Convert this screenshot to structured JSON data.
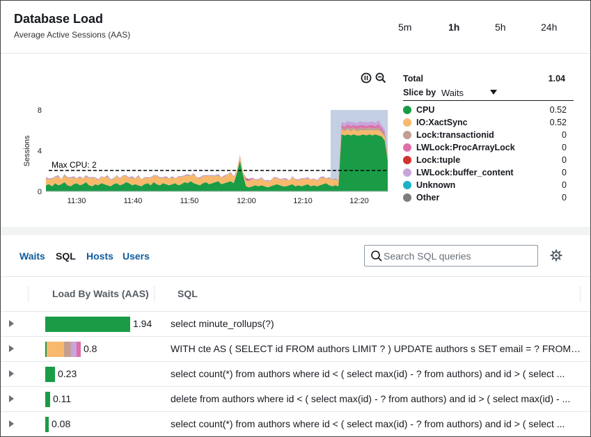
{
  "header": {
    "title": "Database Load",
    "subtitle": "Average Active Sessions (AAS)",
    "time_ranges": [
      "5m",
      "1h",
      "5h",
      "24h"
    ],
    "active_range": "1h"
  },
  "chart_data": {
    "type": "area",
    "ylabel": "Sessions",
    "yticks": [
      "0",
      "4",
      "8"
    ],
    "ylim": [
      0,
      9
    ],
    "xticks": [
      "11:30",
      "11:40",
      "11:50",
      "12:00",
      "12:10",
      "12:20"
    ],
    "threshold": {
      "label": "Max CPU: 2",
      "value": 2
    },
    "selection": {
      "from": "12:15",
      "to": "12:25"
    },
    "series": [
      {
        "name": "CPU",
        "color": "#1a9c46",
        "values": [
          0.6,
          0.7,
          0.5,
          0.8,
          0.6,
          0.7,
          0.9,
          0.6,
          0.5,
          0.7,
          0.8,
          0.6,
          0.7,
          0.9,
          0.6,
          0.5,
          0.7,
          0.6,
          0.8,
          0.7,
          0.6,
          0.5,
          0.7,
          0.8,
          0.6,
          0.7,
          0.9,
          0.8,
          0.6,
          0.7,
          0.6,
          0.5,
          0.7,
          0.8,
          0.6,
          0.9,
          0.7,
          0.6,
          0.8,
          0.7,
          0.6,
          0.7,
          0.8,
          0.6,
          0.7,
          0.9,
          0.8,
          1.0,
          0.8,
          0.7,
          0.6,
          0.8,
          0.9,
          0.7,
          0.8,
          0.9,
          1.0,
          0.7,
          0.8,
          0.9,
          1.0,
          0.8,
          1.8,
          3.0,
          1.6,
          0.5,
          0.4,
          0.5,
          0.6,
          0.5,
          0.6,
          0.5,
          0.4,
          0.5,
          0.6,
          0.7,
          0.6,
          0.5,
          0.5,
          0.6,
          0.7,
          0.5,
          0.6,
          0.5,
          0.6,
          0.7,
          0.5,
          0.6,
          0.5,
          0.6,
          0.7,
          0.8,
          0.6,
          0.5,
          0.6,
          0.5,
          5.6,
          5.5,
          5.6,
          5.5,
          5.6,
          5.5,
          5.5,
          5.6,
          5.5,
          5.6,
          5.5,
          5.6,
          5.5,
          5.4,
          5.0,
          3.0
        ]
      },
      {
        "name": "IO:XactSync",
        "color": "#f8b96d",
        "values": [
          0.6,
          0.5,
          0.7,
          0.6,
          0.8,
          0.5,
          0.6,
          0.7,
          0.8,
          0.6,
          0.5,
          0.7,
          0.6,
          0.5,
          0.7,
          0.8,
          0.6,
          0.5,
          0.6,
          0.7,
          0.8,
          0.6,
          0.5,
          0.7,
          0.6,
          0.8,
          0.6,
          0.5,
          0.7,
          0.6,
          0.8,
          0.7,
          0.6,
          0.5,
          0.7,
          0.6,
          0.8,
          0.7,
          0.5,
          0.6,
          0.7,
          0.6,
          0.5,
          0.8,
          0.7,
          0.6,
          0.7,
          0.6,
          0.8,
          0.7,
          0.6,
          0.7,
          0.6,
          0.8,
          0.7,
          0.6,
          0.5,
          0.7,
          0.6,
          0.8,
          0.7,
          0.6,
          0.3,
          0.4,
          0.3,
          0.5,
          0.6,
          0.7,
          0.5,
          0.6,
          0.7,
          0.5,
          0.6,
          0.5,
          0.7,
          0.6,
          0.5,
          0.7,
          0.6,
          0.5,
          0.7,
          0.6,
          0.5,
          0.7,
          0.6,
          0.5,
          0.7,
          0.6,
          0.5,
          0.7,
          0.6,
          0.5,
          0.6,
          0.7,
          0.5,
          0.6,
          0.5,
          0.4,
          0.5,
          0.4,
          0.5,
          0.4,
          0.5,
          0.4,
          0.5,
          0.4,
          0.5,
          0.4,
          0.5,
          0.4,
          0.4,
          0.3
        ]
      },
      {
        "name": "Lock:transactionid",
        "color": "#c39e91",
        "values": [
          0.1,
          0,
          0.1,
          0,
          0.1,
          0,
          0.1,
          0.1,
          0,
          0.1,
          0,
          0.1,
          0,
          0.1,
          0,
          0.1,
          0,
          0.1,
          0,
          0,
          0.1,
          0,
          0.1,
          0,
          0.1,
          0,
          0.1,
          0,
          0.1,
          0,
          0.1,
          0,
          0,
          0.1,
          0,
          0.1,
          0,
          0.1,
          0,
          0.1,
          0,
          0.1,
          0,
          0,
          0.1,
          0,
          0.1,
          0,
          0.1,
          0,
          0.1,
          0,
          0.1,
          0,
          0.1,
          0,
          0.1,
          0,
          0.1,
          0,
          0.1,
          0,
          0,
          0.1,
          0,
          0.1,
          0,
          0.1,
          0,
          0.1,
          0,
          0,
          0.1,
          0,
          0.1,
          0,
          0.1,
          0,
          0.1,
          0,
          0,
          0.1,
          0,
          0.1,
          0,
          0.1,
          0,
          0,
          0.1,
          0,
          0.1,
          0,
          0.1,
          0,
          0.1,
          0,
          0.2,
          0.2,
          0.2,
          0.3,
          0.2,
          0.2,
          0.3,
          0.2,
          0.2,
          0.3,
          0.2,
          0.2,
          0.3,
          0.2,
          0.2,
          0.1
        ]
      },
      {
        "name": "LWLock:ProcArrayLock",
        "color": "#de6fa9",
        "values": [
          0,
          0,
          0,
          0,
          0,
          0,
          0,
          0,
          0,
          0,
          0,
          0,
          0,
          0,
          0,
          0,
          0,
          0,
          0,
          0,
          0,
          0,
          0,
          0,
          0,
          0,
          0,
          0,
          0,
          0,
          0,
          0,
          0,
          0,
          0,
          0,
          0,
          0,
          0,
          0,
          0,
          0,
          0,
          0,
          0,
          0,
          0,
          0,
          0,
          0,
          0,
          0,
          0,
          0,
          0,
          0,
          0,
          0,
          0,
          0,
          0,
          0,
          0,
          0,
          0,
          0.05,
          0.1,
          0.05,
          0,
          0,
          0,
          0,
          0,
          0,
          0,
          0,
          0,
          0,
          0,
          0,
          0,
          0,
          0,
          0,
          0,
          0,
          0,
          0,
          0,
          0,
          0,
          0,
          0,
          0,
          0,
          0,
          0.2,
          0.2,
          0.3,
          0.2,
          0.2,
          0.3,
          0.2,
          0.3,
          0.2,
          0.2,
          0.3,
          0.2,
          0.3,
          0.2,
          0.2,
          0.1
        ]
      },
      {
        "name": "Lock:tuple",
        "color": "#d23232",
        "values": [
          0,
          0,
          0,
          0,
          0,
          0,
          0,
          0,
          0,
          0,
          0,
          0,
          0,
          0,
          0,
          0,
          0,
          0,
          0,
          0,
          0,
          0,
          0,
          0,
          0,
          0,
          0,
          0,
          0,
          0,
          0,
          0,
          0,
          0,
          0,
          0,
          0,
          0,
          0,
          0,
          0,
          0,
          0,
          0,
          0,
          0,
          0,
          0,
          0,
          0,
          0,
          0,
          0,
          0,
          0,
          0,
          0,
          0,
          0,
          0,
          0,
          0,
          0,
          0,
          0,
          0.1,
          0.05,
          0,
          0,
          0,
          0,
          0,
          0,
          0,
          0,
          0,
          0,
          0,
          0,
          0,
          0,
          0,
          0,
          0,
          0,
          0,
          0,
          0,
          0,
          0,
          0,
          0,
          0,
          0,
          0,
          0,
          0,
          0,
          0,
          0,
          0,
          0,
          0,
          0,
          0,
          0,
          0,
          0,
          0,
          0,
          0,
          0
        ]
      },
      {
        "name": "LWLock:buffer_content",
        "color": "#c8a4da",
        "values": [
          0.1,
          0.1,
          0,
          0.1,
          0.1,
          0,
          0.1,
          0,
          0.1,
          0.1,
          0,
          0.1,
          0,
          0.1,
          0.1,
          0,
          0.1,
          0,
          0.1,
          0,
          0.1,
          0.1,
          0,
          0.1,
          0,
          0.1,
          0,
          0.1,
          0.1,
          0,
          0.1,
          0,
          0.1,
          0,
          0.1,
          0,
          0.1,
          0,
          0.1,
          0.1,
          0,
          0.1,
          0,
          0.1,
          0,
          0.1,
          0.1,
          0,
          0.1,
          0,
          0.1,
          0.1,
          0,
          0.1,
          0,
          0.1,
          0.1,
          0,
          0.1,
          0,
          0.1,
          0.1,
          0,
          0.1,
          0,
          0.1,
          0.1,
          0,
          0.1,
          0,
          0.1,
          0.1,
          0,
          0.1,
          0,
          0.1,
          0,
          0.1,
          0.1,
          0,
          0.1,
          0,
          0.1,
          0,
          0.1,
          0.1,
          0,
          0.1,
          0,
          0.1,
          0.1,
          0,
          0.1,
          0,
          0.1,
          0,
          0.3,
          0.4,
          0.3,
          0.4,
          0.3,
          0.3,
          0.4,
          0.3,
          0.4,
          0.3,
          0.4,
          0.3,
          0.4,
          0.3,
          0.3,
          0.2
        ]
      }
    ]
  },
  "legend": {
    "total_label": "Total",
    "total_value": "1.04",
    "slice_label": "Slice by",
    "slice_value": "Waits",
    "items": [
      {
        "name": "CPU",
        "value": "0.52",
        "color": "#1a9c46"
      },
      {
        "name": "IO:XactSync",
        "value": "0.52",
        "color": "#f8b96d"
      },
      {
        "name": "Lock:transactionid",
        "value": "0",
        "color": "#c39e91"
      },
      {
        "name": "LWLock:ProcArrayLock",
        "value": "0",
        "color": "#de6fa9"
      },
      {
        "name": "Lock:tuple",
        "value": "0",
        "color": "#d23232"
      },
      {
        "name": "LWLock:buffer_content",
        "value": "0",
        "color": "#c8a4da"
      },
      {
        "name": "Unknown",
        "value": "0",
        "color": "#1ab2c8"
      },
      {
        "name": "Other",
        "value": "0",
        "color": "#7d7d7d"
      }
    ]
  },
  "tabs": [
    "Waits",
    "SQL",
    "Hosts",
    "Users"
  ],
  "active_tab": "SQL",
  "search": {
    "placeholder": "Search SQL queries"
  },
  "table": {
    "columns": [
      "Load By Waits (AAS)",
      "SQL"
    ],
    "rows": [
      {
        "load": "1.94",
        "segments": [
          {
            "color": "#1a9c46",
            "value": 1.94
          }
        ],
        "sql": "select minute_rollups(?)"
      },
      {
        "load": "0.8",
        "segments": [
          {
            "color": "#1a9c46",
            "value": 0.02
          },
          {
            "color": "#f8b96d",
            "value": 0.4
          },
          {
            "color": "#c39e91",
            "value": 0.16
          },
          {
            "color": "#c8a4da",
            "value": 0.12
          },
          {
            "color": "#de6fa9",
            "value": 0.1
          }
        ],
        "sql": "WITH cte AS ( SELECT id FROM authors LIMIT ? ) UPDATE authors s SET email = ? FROM cte..."
      },
      {
        "load": "0.23",
        "segments": [
          {
            "color": "#1a9c46",
            "value": 0.23
          }
        ],
        "sql": "select count(*) from authors where id < ( select max(id) - ? from authors) and id > ( select ..."
      },
      {
        "load": "0.11",
        "segments": [
          {
            "color": "#1a9c46",
            "value": 0.11
          }
        ],
        "sql": "delete from authors where id < ( select max(id) - ? from authors) and id > ( select max(id) - ..."
      },
      {
        "load": "0.08",
        "segments": [
          {
            "color": "#1a9c46",
            "value": 0.08
          }
        ],
        "sql": "select count(*) from authors where id < ( select max(id) - ? from authors) and id > ( select ..."
      }
    ]
  }
}
